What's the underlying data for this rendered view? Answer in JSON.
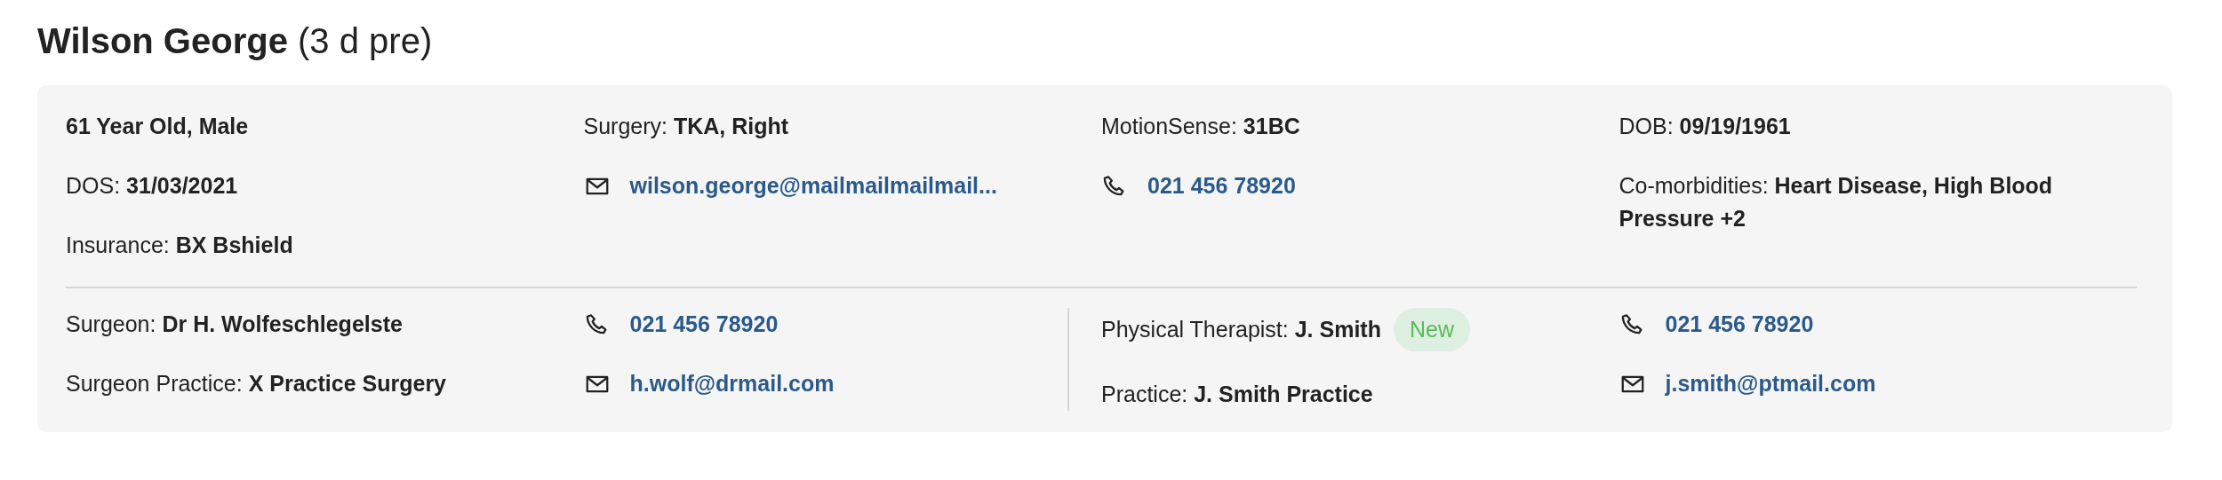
{
  "patient": {
    "name": "Wilson George",
    "status": "(3 d pre)"
  },
  "details": {
    "columns": [
      [
        {
          "kind": "text",
          "text": "**61 Year Old, Male**"
        },
        {
          "kind": "text",
          "text": "DOS: **31/03/2021**"
        },
        {
          "kind": "text",
          "text": "Insurance: **BX Bshield**"
        }
      ],
      [
        {
          "kind": "text",
          "text": "Surgery: **TKA, Right**"
        },
        {
          "kind": "email",
          "text": "wilson.george@mailmailmailmail..."
        }
      ],
      [
        {
          "kind": "text",
          "text": "MotionSense: **31BC**"
        },
        {
          "kind": "phone",
          "text": "021 456 78920"
        }
      ],
      [
        {
          "kind": "text",
          "text": "DOB: **09/19/1961**"
        },
        {
          "kind": "text",
          "text": "Co-morbidities: **Heart Disease, High Blood Pressure +2**"
        }
      ]
    ]
  },
  "care_team": {
    "columns": [
      [
        {
          "kind": "text",
          "text": "Surgeon: **Dr H. Wolfeschlegelste**"
        },
        {
          "kind": "text",
          "text": "Surgeon Practice: **X Practice Surgery**"
        }
      ],
      [
        {
          "kind": "phone",
          "text": "021 456 78920"
        },
        {
          "kind": "email",
          "text": "h.wolf@drmail.com"
        }
      ],
      [
        {
          "kind": "text",
          "text": "Physical Therapist: **J. Smith**",
          "badge": "New"
        },
        {
          "kind": "text",
          "text": "Practice: **J. Smith Practice**"
        }
      ],
      [
        {
          "kind": "phone",
          "text": "021 456 78920"
        },
        {
          "kind": "email",
          "text": "j.smith@ptmail.com"
        }
      ]
    ]
  }
}
